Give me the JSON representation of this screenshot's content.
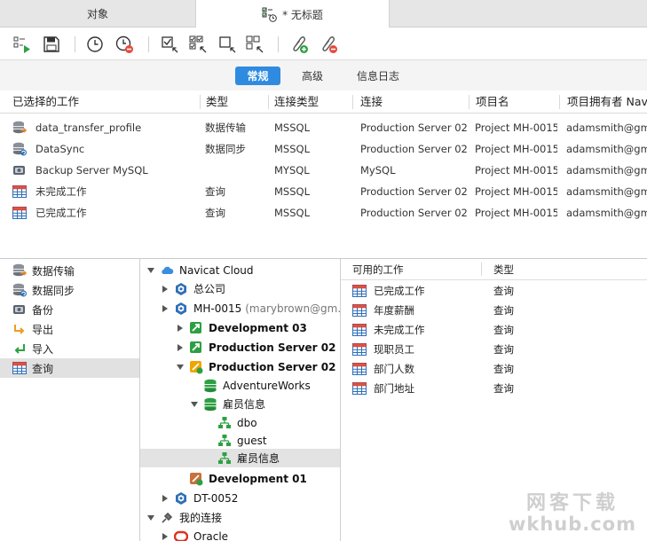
{
  "tabs": [
    {
      "label": "对象"
    },
    {
      "label": "* 无标题"
    }
  ],
  "segments": [
    "常规",
    "高级",
    "信息日志"
  ],
  "jobs_table": {
    "columns": [
      "已选择的工作",
      "类型",
      "连接类型",
      "连接",
      "项目名",
      "项目拥有者 Nav"
    ],
    "rows": [
      {
        "name": "data_transfer_profile",
        "type": "数据传输",
        "conn_type": "MSSQL",
        "connection": "Production Server 02",
        "project": "Project MH-0015",
        "owner": "adamsmith@gma"
      },
      {
        "name": "DataSync",
        "type": "数据同步",
        "conn_type": "MSSQL",
        "connection": "Production Server 02",
        "project": "Project MH-0015",
        "owner": "adamsmith@gma"
      },
      {
        "name": "Backup Server MySQL",
        "type": "",
        "conn_type": "MYSQL",
        "connection": "MySQL",
        "project": "Project MH-0015",
        "owner": "adamsmith@gma"
      },
      {
        "name": "未完成工作",
        "type": "查询",
        "conn_type": "MSSQL",
        "connection": "Production Server 02",
        "project": "Project MH-0015",
        "owner": "adamsmith@gma"
      },
      {
        "name": "已完成工作",
        "type": "查询",
        "conn_type": "MSSQL",
        "connection": "Production Server 02",
        "project": "Project MH-0015",
        "owner": "adamsmith@gma"
      }
    ]
  },
  "job_types": [
    {
      "label": "数据传输",
      "icon": "data-transfer-icon"
    },
    {
      "label": "数据同步",
      "icon": "data-sync-icon"
    },
    {
      "label": "备份",
      "icon": "backup-icon"
    },
    {
      "label": "导出",
      "icon": "export-icon"
    },
    {
      "label": "导入",
      "icon": "import-icon"
    },
    {
      "label": "查询",
      "icon": "query-icon",
      "selected": true
    }
  ],
  "tree": {
    "cloud": "Navicat Cloud",
    "company": "总公司",
    "project": "MH-0015",
    "project_owner": "(marybrown@gm...",
    "dev03": "Development 03",
    "prod02a": "Production Server 02",
    "prod02b": "Production Server 02",
    "db1": "AdventureWorks",
    "db2": "雇员信息",
    "schema1": "dbo",
    "schema2": "guest",
    "schema3": "雇员信息",
    "dev01": "Development 01",
    "dt": "DT-0052",
    "myconn": "我的连接",
    "oracle": "Oracle"
  },
  "available": {
    "col_name": "可用的工作",
    "col_type": "类型",
    "rows": [
      {
        "name": "已完成工作",
        "type": "查询"
      },
      {
        "name": "年度薪酬",
        "type": "查询"
      },
      {
        "name": "未完成工作",
        "type": "查询"
      },
      {
        "name": "现职员工",
        "type": "查询"
      },
      {
        "name": "部门人数",
        "type": "查询"
      },
      {
        "name": "部门地址",
        "type": "查询"
      }
    ]
  },
  "watermark": {
    "line1": "网客下载",
    "line2": "wkhub.com"
  },
  "colors": {
    "accent": "#2f8be0",
    "green": "#29a33b",
    "red": "#e44b3c",
    "db_blue": "#2e6fb7"
  }
}
